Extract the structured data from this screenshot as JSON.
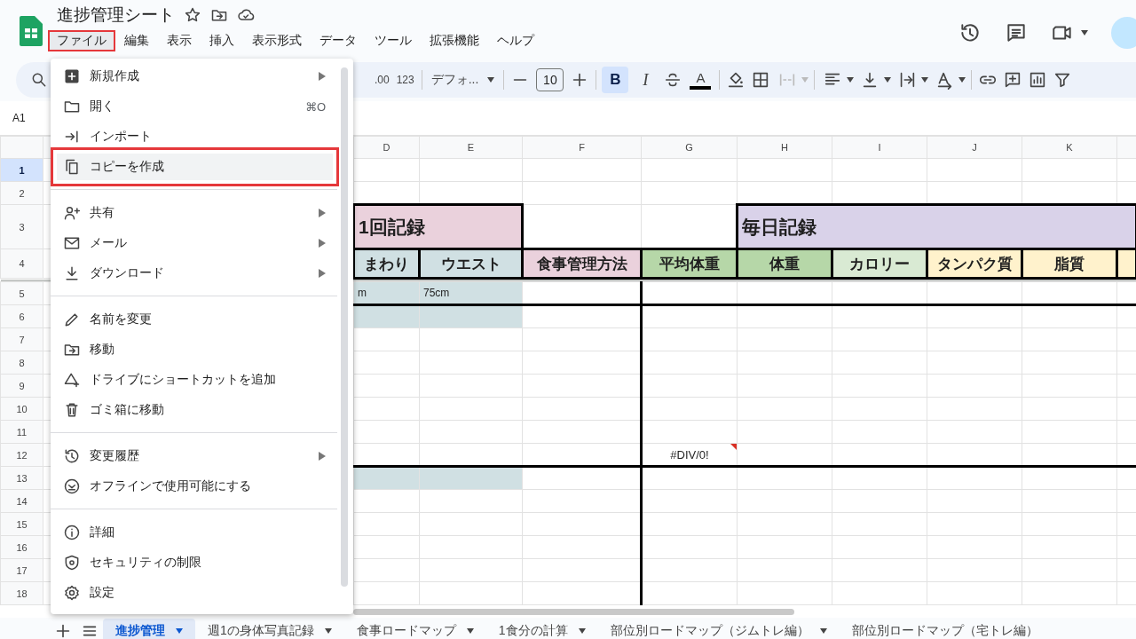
{
  "document": {
    "title": "進捗管理シート"
  },
  "menu_bar": [
    {
      "label": "ファイル",
      "selected": true
    },
    {
      "label": "編集",
      "selected": false
    },
    {
      "label": "表示",
      "selected": false
    },
    {
      "label": "挿入",
      "selected": false
    },
    {
      "label": "表示形式",
      "selected": false
    },
    {
      "label": "データ",
      "selected": false
    },
    {
      "label": "ツール",
      "selected": false
    },
    {
      "label": "拡張機能",
      "selected": false
    },
    {
      "label": "ヘルプ",
      "selected": false
    }
  ],
  "toolbar": {
    "decimal_places": ".00",
    "number_format": "123",
    "font": "デフォ...",
    "font_size": "10",
    "bold": {
      "label": "B",
      "selected": true
    },
    "italic": {
      "label": "I",
      "selected": false
    },
    "text_color": {
      "label": "A"
    }
  },
  "name_box": "A1",
  "columns": [
    "D",
    "E",
    "F",
    "G",
    "H",
    "I",
    "J",
    "K"
  ],
  "rows": [
    {
      "number": "1",
      "selected": true
    },
    {
      "number": "2",
      "selected": false
    },
    {
      "number": "3",
      "selected": false,
      "cells": [
        {
          "text": "1回記録",
          "kind": "title",
          "color": "#ead1dc"
        },
        {},
        {},
        {
          "text": "毎日記録",
          "kind": "title",
          "color": "#d9d2e9"
        }
      ]
    },
    {
      "number": "4",
      "selected": false,
      "cells": [
        {
          "text": "まわり",
          "kind": "heading",
          "color": "#d0e0e3"
        },
        {
          "text": "ウエスト",
          "kind": "heading",
          "color": "#d0e0e3"
        },
        {
          "text": "食事管理方法",
          "kind": "heading",
          "color": "#ead1dc"
        },
        {
          "text": "平均体重",
          "kind": "heading",
          "color": "#b6d7a8"
        },
        {
          "text": "体重",
          "kind": "heading",
          "color": "#b6d7a8"
        },
        {
          "text": "カロリー",
          "kind": "heading",
          "color": "#d9ead3"
        },
        {
          "text": "タンパク質",
          "kind": "heading",
          "color": "#fff2cc"
        },
        {
          "text": "脂質",
          "kind": "heading",
          "color": "#fff2cc"
        },
        {
          "kind": "heading",
          "color": "#fff2cc"
        }
      ]
    },
    {
      "number": "5",
      "selected": false,
      "cells": [
        {
          "text": "m",
          "kind": "value",
          "color": "#d0e0e3"
        },
        {
          "text": "75cm",
          "kind": "value",
          "color": "#d0e0e3"
        }
      ]
    },
    {
      "number": "6",
      "selected": false,
      "cells": [
        {
          "kind": "value",
          "color": "#d0e0e3"
        },
        {
          "kind": "value",
          "color": "#d0e0e3"
        }
      ]
    },
    {
      "number": "7",
      "selected": false
    },
    {
      "number": "8",
      "selected": false
    },
    {
      "number": "9",
      "selected": false
    },
    {
      "number": "10",
      "selected": false
    },
    {
      "number": "11",
      "selected": false
    },
    {
      "number": "12",
      "selected": false,
      "cells": [
        {},
        {},
        {},
        {
          "text": "#DIV/0!",
          "kind": "error"
        }
      ]
    },
    {
      "number": "13",
      "selected": false,
      "cells": [
        {
          "kind": "value",
          "color": "#d0e0e3"
        },
        {
          "kind": "value",
          "color": "#d0e0e3"
        }
      ]
    },
    {
      "number": "14",
      "selected": false
    },
    {
      "number": "15",
      "selected": false
    },
    {
      "number": "16",
      "selected": false
    },
    {
      "number": "17",
      "selected": false
    },
    {
      "number": "18",
      "selected": false
    }
  ],
  "file_menu": {
    "groups": [
      [
        {
          "label": "新規作成",
          "submenu": true,
          "highlighted": false
        },
        {
          "label": "開く",
          "shortcut": "⌘O",
          "submenu": false,
          "highlighted": false
        },
        {
          "label": "インポート",
          "submenu": false,
          "highlighted": false
        },
        {
          "label": "コピーを作成",
          "submenu": false,
          "highlighted": true
        }
      ],
      [
        {
          "label": "共有",
          "submenu": true,
          "highlighted": false
        },
        {
          "label": "メール",
          "submenu": true,
          "highlighted": false
        },
        {
          "label": "ダウンロード",
          "submenu": true,
          "highlighted": false
        }
      ],
      [
        {
          "label": "名前を変更",
          "submenu": false,
          "highlighted": false
        },
        {
          "label": "移動",
          "submenu": false,
          "highlighted": false
        },
        {
          "label": "ドライブにショートカットを追加",
          "submenu": false,
          "highlighted": false
        },
        {
          "label": "ゴミ箱に移動",
          "submenu": false,
          "highlighted": false
        }
      ],
      [
        {
          "label": "変更履歴",
          "submenu": true,
          "highlighted": false
        },
        {
          "label": "オフラインで使用可能にする",
          "submenu": false,
          "highlighted": false
        }
      ],
      [
        {
          "label": "詳細",
          "submenu": false,
          "highlighted": false
        },
        {
          "label": "セキュリティの制限",
          "submenu": false,
          "highlighted": false
        },
        {
          "label": "設定",
          "submenu": false,
          "highlighted": false
        }
      ]
    ]
  },
  "sheet_tabs": [
    {
      "label": "進捗管理",
      "selected": true
    },
    {
      "label": "週1の身体写真記録",
      "selected": false
    },
    {
      "label": "食事ロードマップ",
      "selected": false
    },
    {
      "label": "1食分の計算",
      "selected": false
    },
    {
      "label": "部位別ロードマップ（ジムトレ編）",
      "selected": false
    },
    {
      "label": "部位別ロードマップ（宅トレ編）",
      "selected": false
    }
  ]
}
